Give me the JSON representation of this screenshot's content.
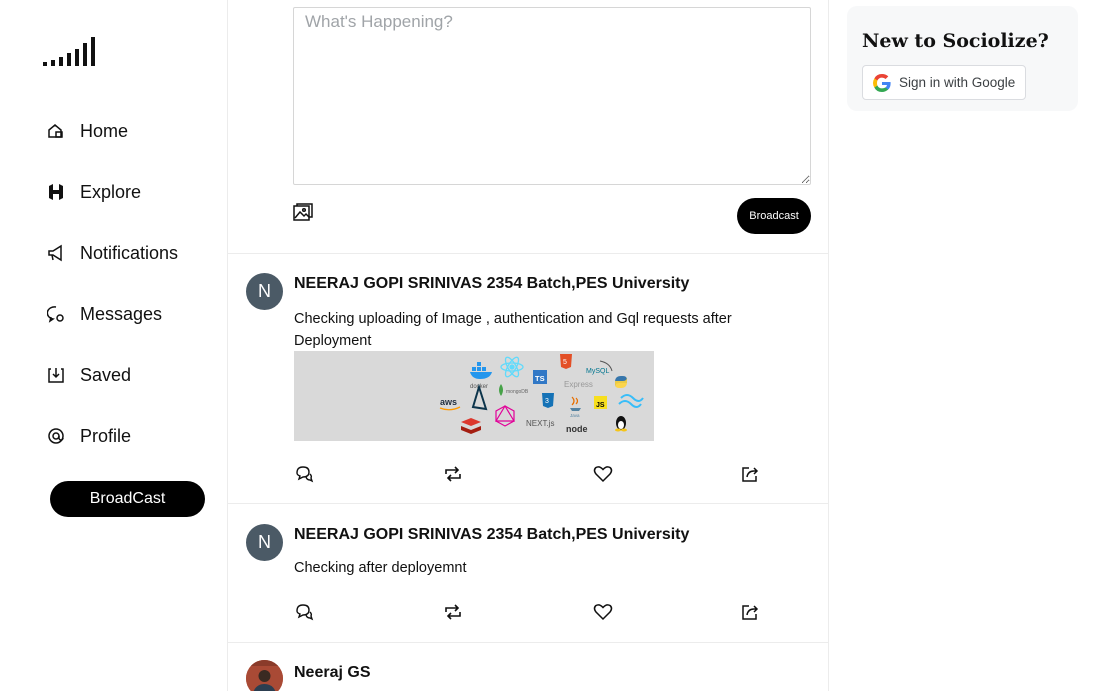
{
  "sidebar": {
    "nav": [
      {
        "label": "Home",
        "icon": "home-icon"
      },
      {
        "label": "Explore",
        "icon": "hashtag-icon"
      },
      {
        "label": "Notifications",
        "icon": "megaphone-icon"
      },
      {
        "label": "Messages",
        "icon": "chat-icon"
      },
      {
        "label": "Saved",
        "icon": "download-icon"
      },
      {
        "label": "Profile",
        "icon": "at-icon"
      }
    ],
    "broadcast_label": "BroadCast"
  },
  "composer": {
    "placeholder": "What's Happening?",
    "submit_label": "Broadcast"
  },
  "posts": [
    {
      "avatar_letter": "N",
      "author": "NEERAJ GOPI SRINIVAS 2354 Batch,PES University",
      "text": "Checking uploading of Image , authentication and Gql requests after Deployment",
      "has_image": true,
      "image_labels": [
        "docker",
        "TS",
        "MySQL",
        "Express",
        "aws",
        "mongoDB",
        "JS",
        "NEXT.js",
        "node",
        "Java"
      ]
    },
    {
      "avatar_letter": "N",
      "author": "NEERAJ GOPI SRINIVAS 2354 Batch,PES University",
      "text": "Checking after deployemnt",
      "has_image": false
    },
    {
      "avatar_letter": "",
      "author": "Neeraj GS",
      "text": "",
      "has_image": false
    }
  ],
  "right_panel": {
    "title": "New to Sociolize?",
    "google_label": "Sign in with Google"
  },
  "colors": {
    "accent": "#000000",
    "avatar_bg": "#4b5a66",
    "border": "#ececec",
    "card_bg": "#f7f8f9"
  }
}
